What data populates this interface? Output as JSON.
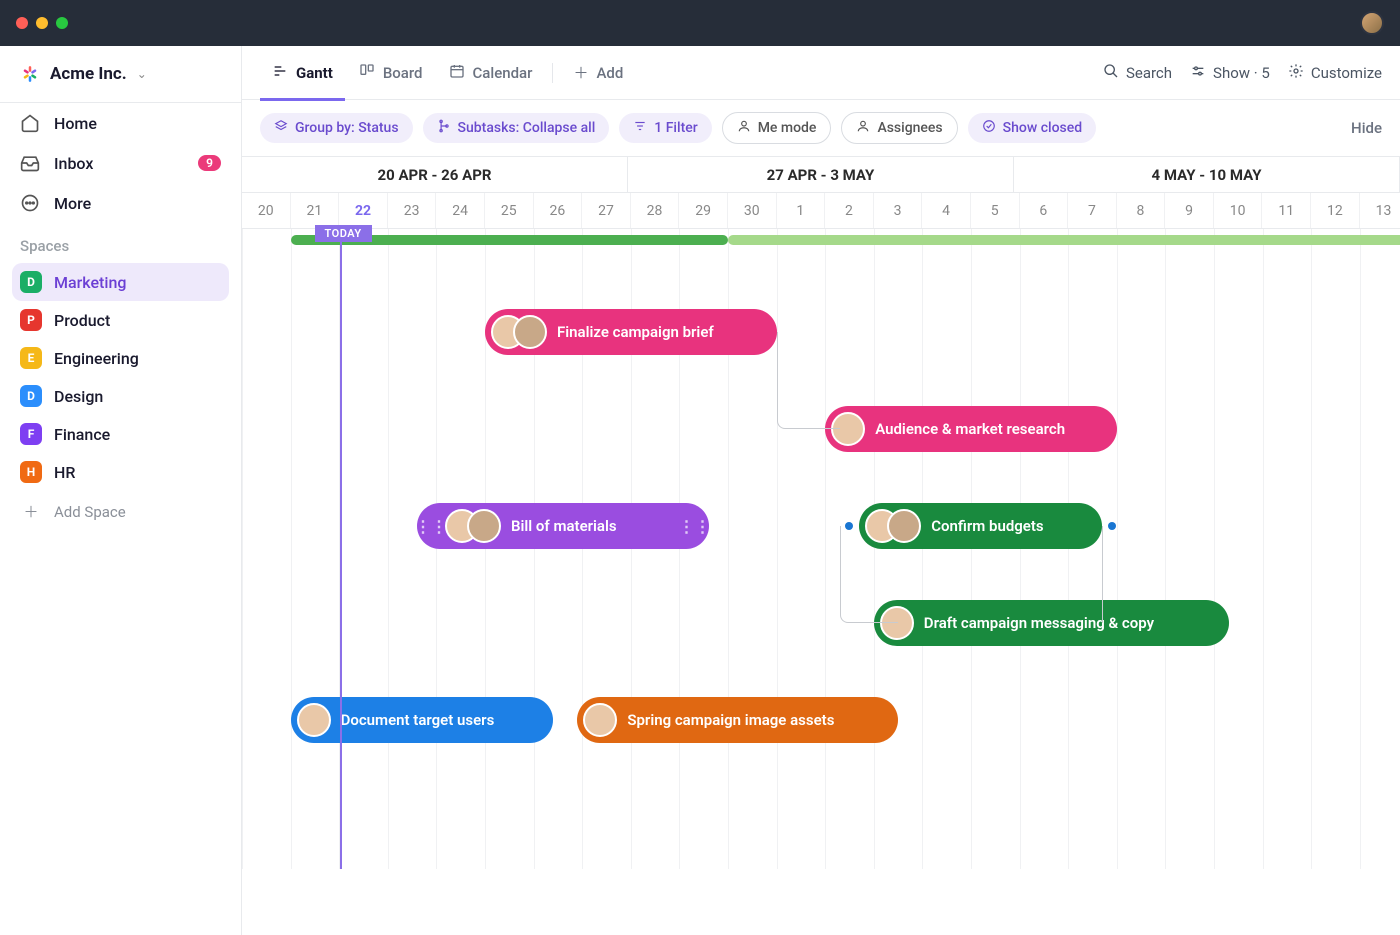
{
  "workspace": {
    "name": "Acme Inc."
  },
  "nav": {
    "home": "Home",
    "inbox": "Inbox",
    "inbox_count": "9",
    "more": "More"
  },
  "spaces": {
    "label": "Spaces",
    "items": [
      {
        "letter": "D",
        "label": "Marketing",
        "color": "#1aae66",
        "active": true
      },
      {
        "letter": "P",
        "label": "Product",
        "color": "#e6362e",
        "active": false
      },
      {
        "letter": "E",
        "label": "Engineering",
        "color": "#f5b818",
        "active": false
      },
      {
        "letter": "D",
        "label": "Design",
        "color": "#2b8efc",
        "active": false
      },
      {
        "letter": "F",
        "label": "Finance",
        "color": "#7e3ff2",
        "active": false
      },
      {
        "letter": "H",
        "label": "HR",
        "color": "#f06a13",
        "active": false
      }
    ],
    "add_label": "Add Space"
  },
  "views": {
    "gantt": "Gantt",
    "board": "Board",
    "calendar": "Calendar",
    "add": "Add"
  },
  "top_right": {
    "search": "Search",
    "show": "Show · 5",
    "customize": "Customize"
  },
  "filters": {
    "group_by": "Group by: Status",
    "subtasks": "Subtasks: Collapse all",
    "filter": "1 Filter",
    "me_mode": "Me mode",
    "assignees": "Assignees",
    "show_closed": "Show closed",
    "hide": "Hide"
  },
  "timeline": {
    "weeks": [
      "20 APR - 26 APR",
      "27 APR - 3 MAY",
      "4 MAY - 10 MAY"
    ],
    "days": [
      "20",
      "21",
      "22",
      "23",
      "24",
      "25",
      "26",
      "27",
      "28",
      "29",
      "30",
      "1",
      "2",
      "3",
      "4",
      "5",
      "6",
      "7",
      "8",
      "9",
      "10",
      "11",
      "12",
      "13"
    ],
    "today_index": 2,
    "today_label": "TODAY"
  },
  "tasks": [
    {
      "id": "t1",
      "label": "Finalize campaign brief",
      "color": "#e8337e",
      "row": 0,
      "start": 5,
      "span": 6,
      "avatars": 2
    },
    {
      "id": "t2",
      "label": "Audience & market research",
      "color": "#e8337e",
      "row": 1,
      "start": 12,
      "span": 6,
      "avatars": 1
    },
    {
      "id": "t3",
      "label": "Bill of materials",
      "color": "#9a4de0",
      "row": 2,
      "start": 3.6,
      "span": 6,
      "avatars": 2,
      "handles": true
    },
    {
      "id": "t4",
      "label": "Confirm budgets",
      "color": "#198a3e",
      "row": 2,
      "start": 12.7,
      "span": 5,
      "avatars": 2,
      "milestones": true
    },
    {
      "id": "t5",
      "label": "Draft campaign messaging & copy",
      "color": "#198a3e",
      "row": 3,
      "start": 13,
      "span": 7.3,
      "avatars": 1
    },
    {
      "id": "t6",
      "label": "Document target users",
      "color": "#1d80e6",
      "row": 4,
      "start": 1,
      "span": 5.4,
      "avatars": 1
    },
    {
      "id": "t7",
      "label": "Spring campaign image assets",
      "color": "#e06812",
      "row": 4,
      "start": 6.9,
      "span": 6.6,
      "avatars": 1
    }
  ]
}
